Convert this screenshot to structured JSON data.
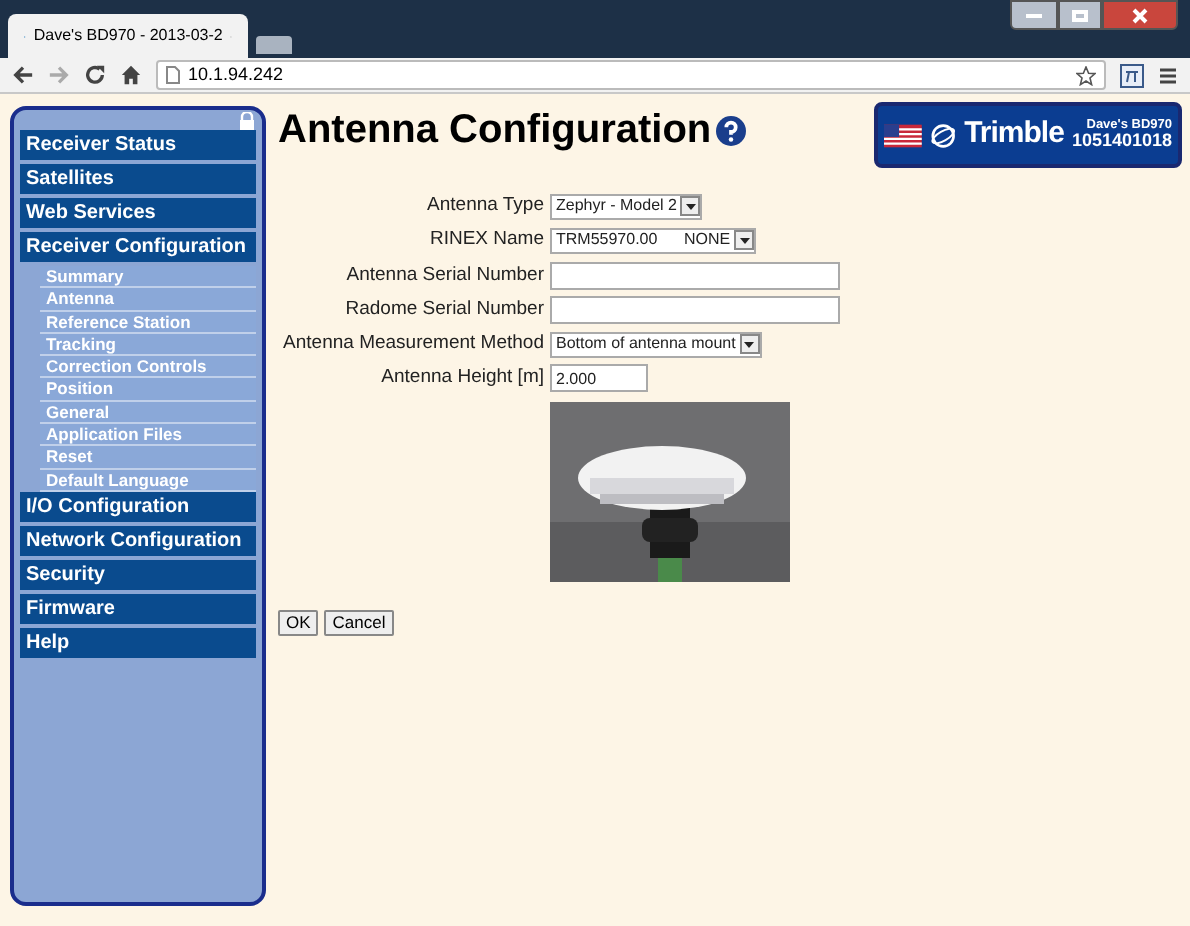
{
  "browser": {
    "tab_title": "Dave's BD970 - 2013-03-2",
    "url": "10.1.94.242"
  },
  "sidebar": {
    "items": [
      {
        "label": "Receiver Status",
        "kind": "main"
      },
      {
        "label": "Satellites",
        "kind": "main"
      },
      {
        "label": "Web Services",
        "kind": "main"
      },
      {
        "label": "Receiver Configuration",
        "kind": "main"
      },
      {
        "label": "Summary",
        "kind": "sub"
      },
      {
        "label": "Antenna",
        "kind": "sub"
      },
      {
        "label": "Reference Station",
        "kind": "sub"
      },
      {
        "label": "Tracking",
        "kind": "sub"
      },
      {
        "label": "Correction Controls",
        "kind": "sub"
      },
      {
        "label": "Position",
        "kind": "sub"
      },
      {
        "label": "General",
        "kind": "sub"
      },
      {
        "label": "Application Files",
        "kind": "sub"
      },
      {
        "label": "Reset",
        "kind": "sub"
      },
      {
        "label": "Default Language",
        "kind": "sub"
      },
      {
        "label": "I/O Configuration",
        "kind": "main"
      },
      {
        "label": "Network Configuration",
        "kind": "main"
      },
      {
        "label": "Security",
        "kind": "main"
      },
      {
        "label": "Firmware",
        "kind": "main"
      },
      {
        "label": "Help",
        "kind": "main"
      }
    ]
  },
  "page": {
    "title": "Antenna Configuration",
    "logo": {
      "brand": "Trimble",
      "receiver_name": "Dave's BD970",
      "serial": "1051401018"
    },
    "fields": [
      {
        "label": "Antenna Type",
        "kind": "select",
        "value": "Zephyr - Model 2"
      },
      {
        "label": "RINEX Name",
        "kind": "select",
        "value": "TRM55970.00      NONE"
      },
      {
        "label": "Antenna Serial Number",
        "kind": "input"
      },
      {
        "label": "Radome Serial Number",
        "kind": "input"
      },
      {
        "label": "Antenna Measurement Method",
        "kind": "select",
        "value": "Bottom of antenna mount"
      },
      {
        "label": "Antenna Height [m]",
        "kind": "short_input",
        "value": "2.000"
      }
    ],
    "buttons": [
      "OK",
      "Cancel"
    ]
  }
}
